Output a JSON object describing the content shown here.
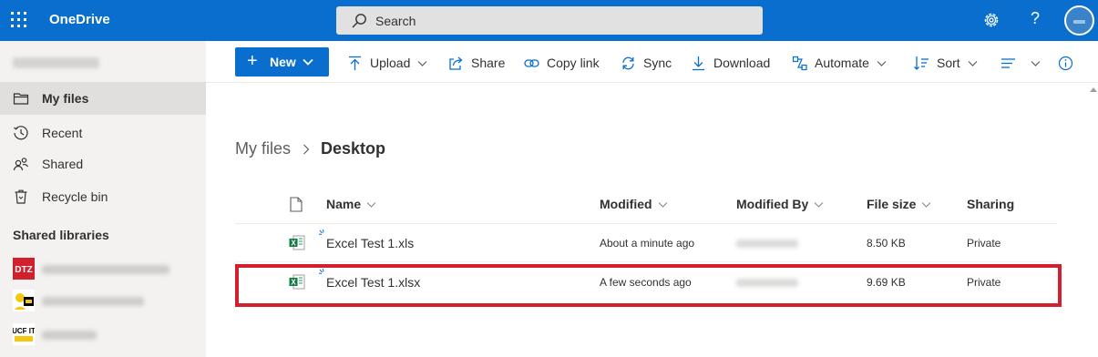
{
  "app": {
    "title": "OneDrive"
  },
  "search": {
    "placeholder": "Search"
  },
  "help": {
    "glyph": "?"
  },
  "sidebar": {
    "items": [
      {
        "label": "My files",
        "icon": "folder-icon",
        "active": true
      },
      {
        "label": "Recent",
        "icon": "clock-icon"
      },
      {
        "label": "Shared",
        "icon": "people-icon"
      },
      {
        "label": "Recycle bin",
        "icon": "trash-icon"
      }
    ],
    "section_title": "Shared libraries",
    "libraries": [
      {
        "logo_text": "DTZ",
        "color": "#d21f2e"
      },
      {
        "logo_text": "",
        "color": "#f2c811"
      },
      {
        "logo_text": "UCF IT",
        "color": "#000000"
      }
    ]
  },
  "toolbar": {
    "new_label": "New",
    "upload_label": "Upload",
    "share_label": "Share",
    "copylink_label": "Copy link",
    "sync_label": "Sync",
    "download_label": "Download",
    "automate_label": "Automate",
    "sort_label": "Sort"
  },
  "breadcrumb": {
    "parent": "My files",
    "current": "Desktop"
  },
  "table": {
    "headers": {
      "name": "Name",
      "modified": "Modified",
      "modified_by": "Modified By",
      "file_size": "File size",
      "sharing": "Sharing"
    },
    "rows": [
      {
        "name": "Excel Test 1.xls",
        "modified": "About a minute ago",
        "size": "8.50 KB",
        "sharing": "Private"
      },
      {
        "name": "Excel Test 1.xlsx",
        "modified": "A few seconds ago",
        "size": "9.69 KB",
        "sharing": "Private"
      }
    ]
  },
  "colors": {
    "accent": "#0a6ecf",
    "highlight": "#d21f2e",
    "excel": "#107c41"
  }
}
